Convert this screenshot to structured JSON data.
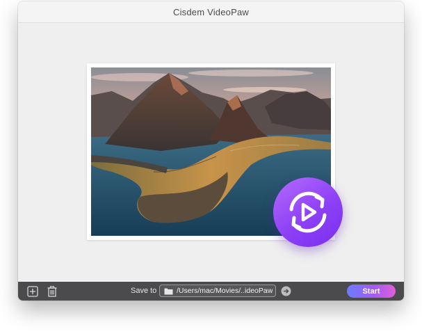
{
  "window": {
    "title": "Cisdem VideoPaw"
  },
  "preview": {
    "icons": {
      "thumbnail": "landscape-thumbnail",
      "convert": "convert-play-icon"
    }
  },
  "bottombar": {
    "add_icon": "add-file-icon",
    "delete_icon": "trash-icon",
    "save_label": "Save to",
    "save_path": "/Users/mac/Movies/..ideoPaw",
    "folder_icon": "folder-icon",
    "go_icon": "arrow-right-icon",
    "start_label": "Start"
  },
  "colors": {
    "accent_start": "#6a7cff",
    "accent_end": "#e05fd8",
    "badge": "#8d40f5",
    "toolbar": "#4b4b4d"
  }
}
